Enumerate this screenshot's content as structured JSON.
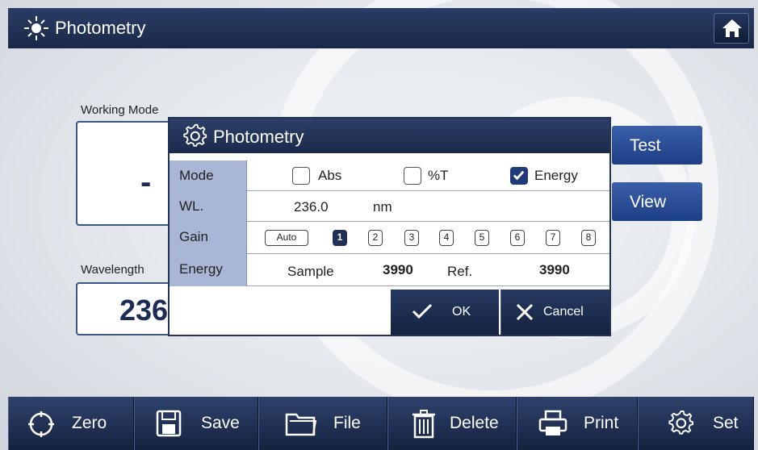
{
  "header": {
    "title": "Photometry",
    "home_icon": "home-icon"
  },
  "main": {
    "working_mode_label": "Working Mode",
    "working_mode_value": "-",
    "wavelength_label": "Wavelength",
    "wavelength_value": "236",
    "test_button": "Test",
    "view_button": "View"
  },
  "dialog": {
    "title": "Photometry",
    "mode_label": "Mode",
    "mode_options": [
      {
        "label": "Abs",
        "checked": false
      },
      {
        "label": "%T",
        "checked": false
      },
      {
        "label": "Energy",
        "checked": true
      }
    ],
    "wl_label": "WL.",
    "wl_value": "236.0",
    "wl_unit": "nm",
    "gain_label": "Gain",
    "gain_options": [
      "Auto",
      "1",
      "2",
      "3",
      "4",
      "5",
      "6",
      "7",
      "8"
    ],
    "gain_selected": "1",
    "energy_label": "Energy",
    "sample_label": "Sample",
    "sample_value": "3990",
    "ref_label": "Ref.",
    "ref_value": "3990",
    "ok_label": "OK",
    "cancel_label": "Cancel"
  },
  "toolbar": {
    "zero": "Zero",
    "save": "Save",
    "file": "File",
    "delete": "Delete",
    "print": "Print",
    "set": "Set"
  },
  "colors": {
    "header_bg": "#1f2d4f",
    "accent_blue": "#2a4f9c",
    "label_cell_bg": "#aab6d6"
  }
}
